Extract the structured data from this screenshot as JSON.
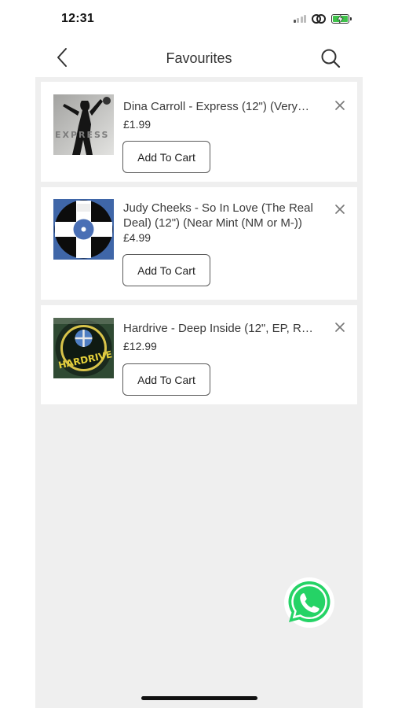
{
  "status_bar": {
    "time": "12:31"
  },
  "nav": {
    "title": "Favourites"
  },
  "favourites": [
    {
      "title": "Dina Carroll - Express (12\") (Very…",
      "price": "£1.99",
      "button_label": "Add To Cart",
      "cover_text": "EXPRESS"
    },
    {
      "title": "Judy Cheeks - So In Love (The Real Deal) (12\") (Near Mint (NM or M-))",
      "price": "£4.99",
      "button_label": "Add To Cart"
    },
    {
      "title": "Hardrive - Deep Inside (12\", EP, R…",
      "price": "£12.99",
      "button_label": "Add To Cart",
      "cover_text": "HARDRIVE"
    }
  ],
  "colors": {
    "whatsapp": "#25d366",
    "background": "#efefef",
    "battery": "#3ec24a"
  }
}
